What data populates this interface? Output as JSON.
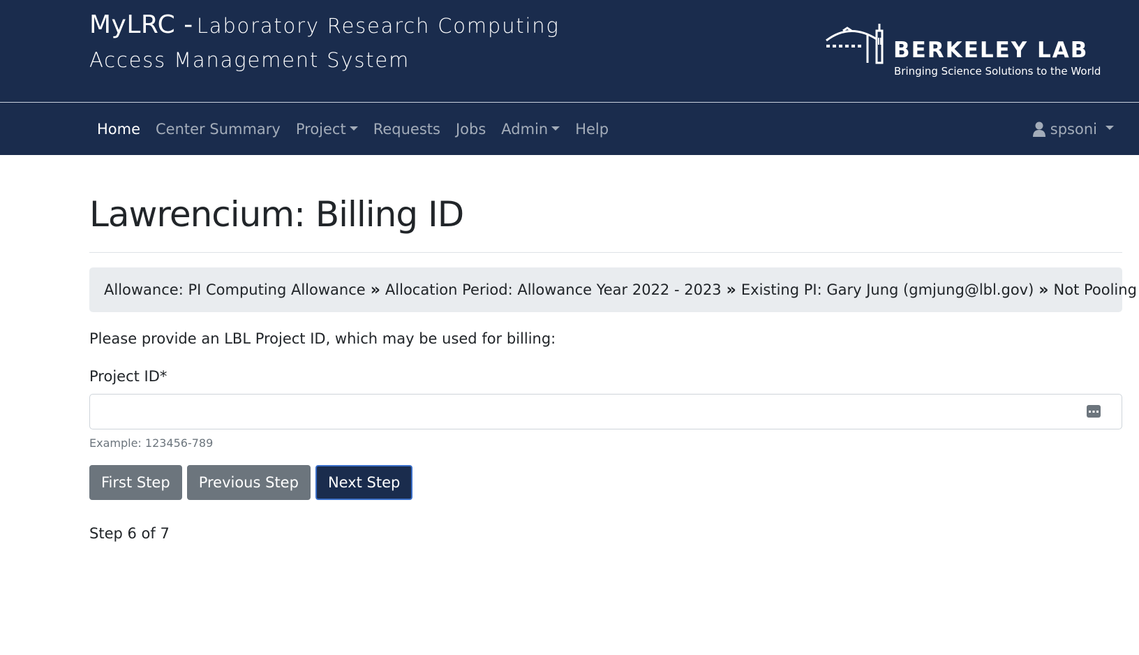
{
  "header": {
    "brand_name": "MyLRC -",
    "brand_subtitle_line1": "Laboratory Research Computing",
    "brand_subtitle_line2": "Access Management System",
    "logo_name": "BERKELEY LAB",
    "logo_tagline": "Bringing Science Solutions to the World"
  },
  "nav": {
    "items": [
      {
        "label": "Home",
        "active": true
      },
      {
        "label": "Center Summary"
      },
      {
        "label": "Project",
        "dropdown": true
      },
      {
        "label": "Requests"
      },
      {
        "label": "Jobs"
      },
      {
        "label": "Admin",
        "dropdown": true
      },
      {
        "label": "Help"
      }
    ],
    "user": {
      "label": "spsoni",
      "icon": "user-icon"
    }
  },
  "page": {
    "title": "Lawrencium: Billing ID",
    "breadcrumb": [
      "Allowance: PI Computing Allowance",
      "Allocation Period: Allowance Year 2022 - 2023",
      "Existing PI: Gary Jung (gmjung@lbl.gov)",
      "Not Pooling"
    ],
    "breadcrumb_separator": "»",
    "intro": "Please provide an LBL Project ID, which may be used for billing:",
    "field_label": "Project ID*",
    "field_value": "",
    "field_help": "Example: 123456-789",
    "buttons": {
      "first": "First Step",
      "previous": "Previous Step",
      "next": "Next Step"
    },
    "step_text": "Step 6 of 7"
  },
  "colors": {
    "header_bg": "#1a2c4d",
    "secondary_button": "#6c757d",
    "primary_button": "#1a2c4d"
  }
}
